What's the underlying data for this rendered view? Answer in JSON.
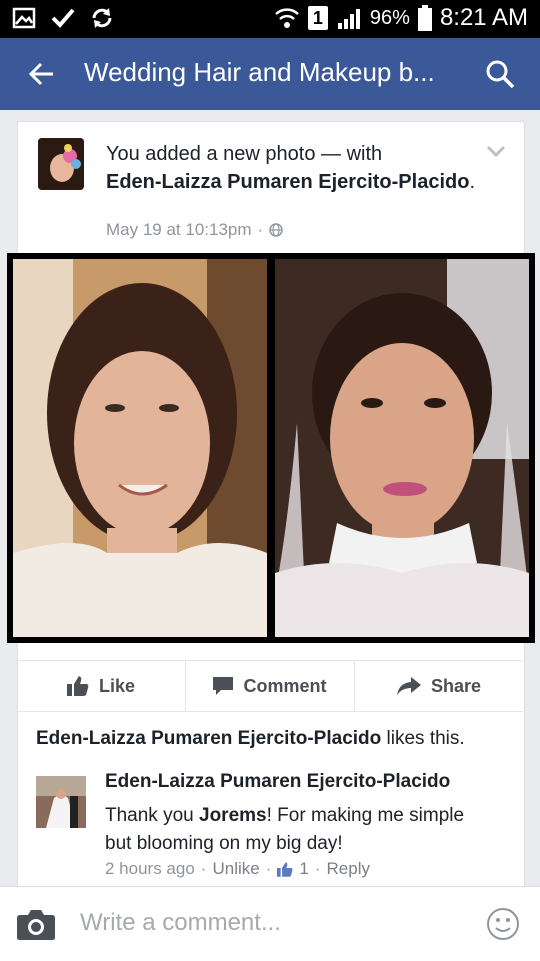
{
  "status": {
    "battery": "96%",
    "time": "8:21 AM",
    "sim": "1"
  },
  "appbar": {
    "title": "Wedding Hair and Makeup b..."
  },
  "post": {
    "prefix": "You added a new photo — with",
    "tagged": "Eden-Laizza Pumaren Ejercito-Placido",
    "suffix": ".",
    "date": "May 19 at 10:13pm",
    "dot": "·"
  },
  "actions": {
    "like": "Like",
    "comment": "Comment",
    "share": "Share"
  },
  "likes": {
    "name": "Eden-Laizza Pumaren Ejercito-Placido",
    "text": " likes this."
  },
  "comment": {
    "author": "Eden-Laizza Pumaren Ejercito-Placido",
    "pre": "Thank you ",
    "mention": "Jorems",
    "post": "! For making me simple but blooming on my big day!",
    "time": "2 hours ago",
    "unlike": "Unlike",
    "like_count": "1",
    "reply": "Reply",
    "sep": "·"
  },
  "composer": {
    "placeholder": "Write a comment..."
  },
  "colors": {
    "brand": "#3b5998",
    "meta": "#90949c"
  },
  "icons": [
    "gallery-icon",
    "check-icon",
    "sync-icon",
    "wifi-icon",
    "signal-icon",
    "battery-icon",
    "back-arrow-icon",
    "search-icon",
    "chevron-down-icon",
    "globe-icon",
    "like-icon",
    "comment-icon",
    "share-icon",
    "camera-icon",
    "smiley-icon"
  ]
}
